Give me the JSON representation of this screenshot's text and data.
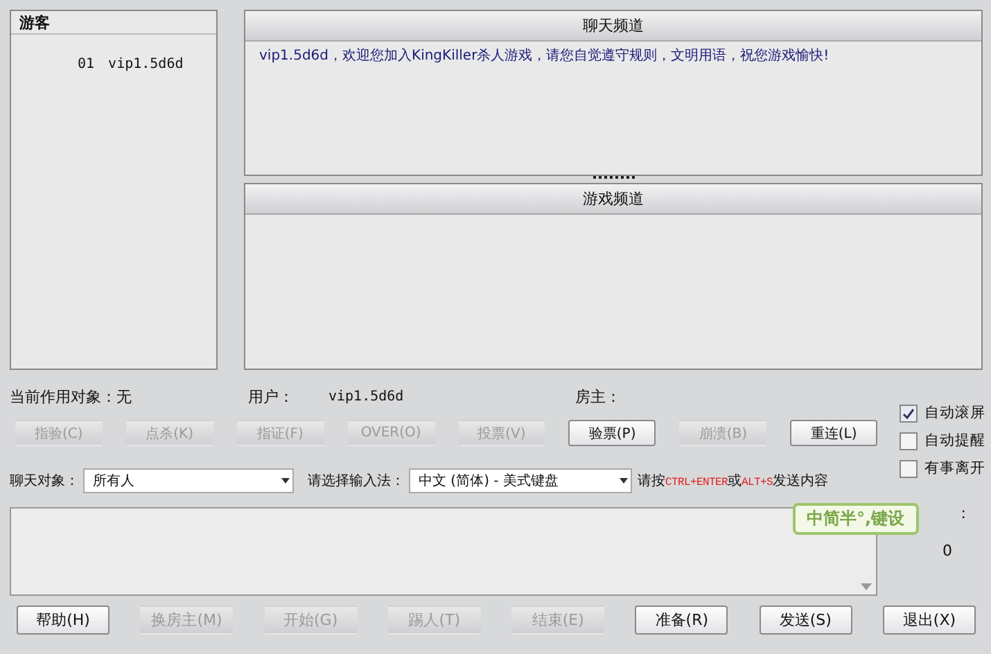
{
  "guest_panel": {
    "title": "游客",
    "players": [
      {
        "number": "01",
        "name": "vip1.5d6d"
      }
    ]
  },
  "chat_channel": {
    "title": "聊天频道",
    "messages": [
      "vip1.5d6d，欢迎您加入KingKiller杀人游戏，请您自觉遵守规则，文明用语，祝您游戏愉快!"
    ]
  },
  "game_channel": {
    "title": "游戏频道"
  },
  "info": {
    "target": "当前作用对象：无",
    "user_label": "用户：",
    "user": "vip1.5d6d",
    "host_label": "房主："
  },
  "action_buttons": [
    {
      "label": "指验(C)",
      "disabled": true
    },
    {
      "label": "点杀(K)",
      "disabled": true
    },
    {
      "label": "指证(F)",
      "disabled": true
    },
    {
      "label": "OVER(O)",
      "disabled": true
    },
    {
      "label": "投票(V)",
      "disabled": true
    },
    {
      "label": "验票(P)",
      "disabled": false
    },
    {
      "label": "崩溃(B)",
      "disabled": true
    },
    {
      "label": "重连(L)",
      "disabled": false
    }
  ],
  "options": [
    {
      "label": "自动滚屏",
      "checked": true
    },
    {
      "label": "自动提醒",
      "checked": false
    },
    {
      "label": "有事离开",
      "checked": false
    }
  ],
  "chat_target": {
    "label": "聊天对象：",
    "value": "所有人"
  },
  "input_method": {
    "label": "请选择输入法：",
    "value": "中文 (简体) - 美式键盘"
  },
  "send_hint": [
    {
      "text": "请按",
      "highlight": false
    },
    {
      "text": "CTRL+ENTER",
      "highlight": true
    },
    {
      "text": "或",
      "highlight": false
    },
    {
      "text": "ALT+S",
      "highlight": true
    },
    {
      "text": "发送内容",
      "highlight": false
    }
  ],
  "counter": {
    "label": ":",
    "value": "0"
  },
  "ime_toolbar": {
    "text": "中简半°,键设"
  },
  "bottom_buttons": [
    {
      "label": "帮助(H)",
      "disabled": false
    },
    {
      "label": "换房主(M)",
      "disabled": true
    },
    {
      "label": "开始(G)",
      "disabled": true
    },
    {
      "label": "踢人(T)",
      "disabled": true
    },
    {
      "label": "结束(E)",
      "disabled": true
    },
    {
      "label": "准备(R)",
      "disabled": false
    },
    {
      "label": "发送(S)",
      "disabled": false
    },
    {
      "label": "退出(X)",
      "disabled": false
    }
  ]
}
